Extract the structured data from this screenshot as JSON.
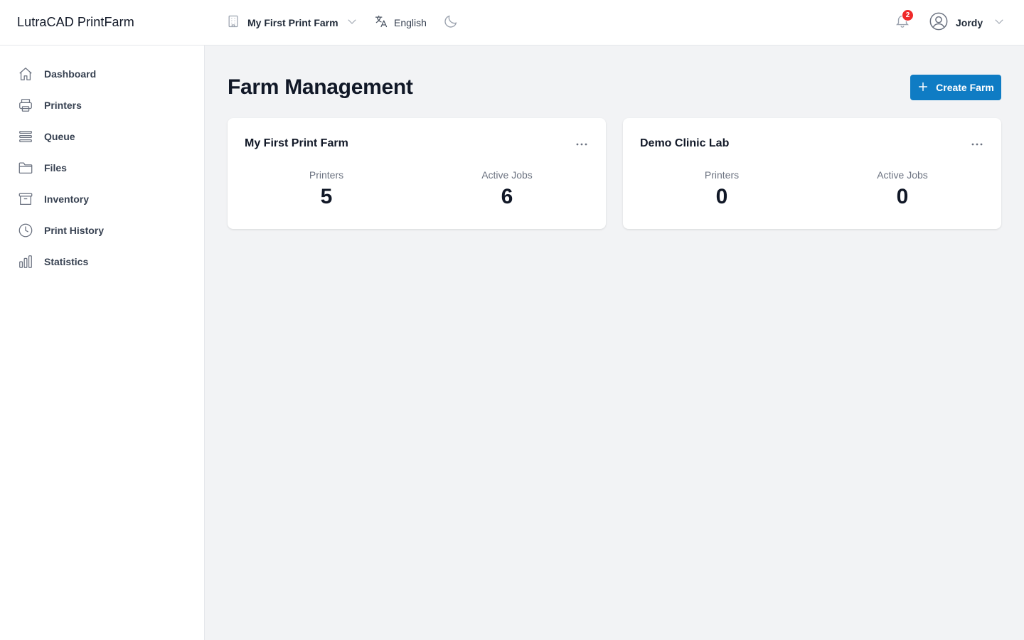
{
  "app": {
    "title": "LutraCAD PrintFarm"
  },
  "header": {
    "farm_selector": "My First Print Farm",
    "language": "English",
    "notifications_count": "2",
    "user_name": "Jordy"
  },
  "sidebar": {
    "items": [
      {
        "label": "Dashboard",
        "icon": "home-icon"
      },
      {
        "label": "Printers",
        "icon": "printer-icon"
      },
      {
        "label": "Queue",
        "icon": "queue-icon"
      },
      {
        "label": "Files",
        "icon": "folder-icon"
      },
      {
        "label": "Inventory",
        "icon": "archive-icon"
      },
      {
        "label": "Print History",
        "icon": "clock-icon"
      },
      {
        "label": "Statistics",
        "icon": "bar-chart-icon"
      }
    ]
  },
  "main": {
    "title": "Farm Management",
    "create_button": "Create Farm",
    "farms": [
      {
        "name": "My First Print Farm",
        "printers_label": "Printers",
        "printers": "5",
        "jobs_label": "Active Jobs",
        "active_jobs": "6"
      },
      {
        "name": "Demo Clinic Lab",
        "printers_label": "Printers",
        "printers": "0",
        "jobs_label": "Active Jobs",
        "active_jobs": "0"
      }
    ]
  },
  "colors": {
    "accent": "#0f7cc4",
    "badge": "#ef2a2a",
    "background": "#f2f3f5"
  }
}
